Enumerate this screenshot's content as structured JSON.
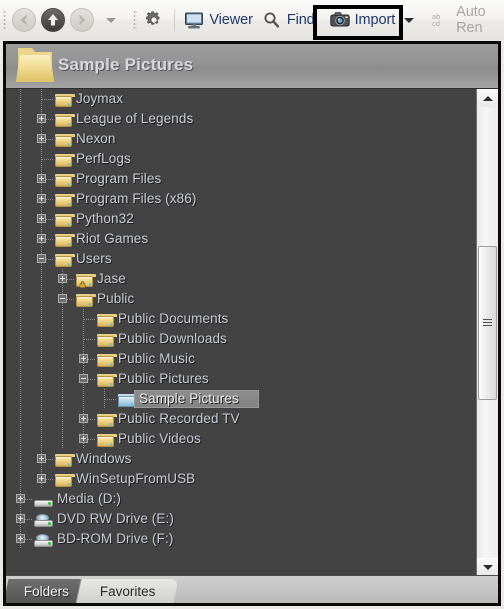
{
  "toolbar": {
    "nav": [
      {
        "name": "back-button",
        "state": "disabled",
        "icon": "arrow-left-icon"
      },
      {
        "name": "up-button",
        "state": "enabled",
        "icon": "arrow-up-icon"
      },
      {
        "name": "forward-button",
        "state": "disabled",
        "icon": "arrow-right-icon"
      },
      {
        "name": "history-dropdown",
        "state": "enabled",
        "icon": "chevron-down-icon"
      }
    ],
    "settings_icon": "gear-icon",
    "items": [
      {
        "label": "Viewer",
        "icon": "monitor-icon",
        "disabled": false,
        "highlighted": false,
        "dropdown": false
      },
      {
        "label": "Find",
        "icon": "magnifier-icon",
        "disabled": false,
        "highlighted": false,
        "dropdown": false
      },
      {
        "label": "Import",
        "icon": "camera-icon",
        "disabled": false,
        "highlighted": true,
        "dropdown": true
      },
      {
        "label": "Auto Ren",
        "icon": "abcd-icon",
        "disabled": true,
        "highlighted": false,
        "dropdown": false
      }
    ],
    "link_color": "#20386b",
    "highlight_color": "#000000"
  },
  "header": {
    "title": "Sample Pictures",
    "icon": "folder-icon"
  },
  "tree": {
    "selected": "Sample Pictures",
    "nodes": [
      {
        "label": "Joymax",
        "depth": 1,
        "expander": "none",
        "icon": "folder-icon"
      },
      {
        "label": "League of Legends",
        "depth": 1,
        "expander": "plus",
        "icon": "folder-icon"
      },
      {
        "label": "Nexon",
        "depth": 1,
        "expander": "plus",
        "icon": "folder-icon"
      },
      {
        "label": "PerfLogs",
        "depth": 1,
        "expander": "none",
        "icon": "folder-icon"
      },
      {
        "label": "Program Files",
        "depth": 1,
        "expander": "plus",
        "icon": "folder-icon"
      },
      {
        "label": "Program Files (x86)",
        "depth": 1,
        "expander": "plus",
        "icon": "folder-icon"
      },
      {
        "label": "Python32",
        "depth": 1,
        "expander": "plus",
        "icon": "folder-icon"
      },
      {
        "label": "Riot Games",
        "depth": 1,
        "expander": "plus",
        "icon": "folder-icon"
      },
      {
        "label": "Users",
        "depth": 1,
        "expander": "minus",
        "icon": "folder-icon"
      },
      {
        "label": "Jase",
        "depth": 2,
        "expander": "plus",
        "icon": "folder-locked-icon"
      },
      {
        "label": "Public",
        "depth": 2,
        "expander": "minus",
        "icon": "folder-icon"
      },
      {
        "label": "Public Documents",
        "depth": 3,
        "expander": "none",
        "icon": "folder-icon"
      },
      {
        "label": "Public Downloads",
        "depth": 3,
        "expander": "none",
        "icon": "folder-icon"
      },
      {
        "label": "Public Music",
        "depth": 3,
        "expander": "plus",
        "icon": "folder-icon"
      },
      {
        "label": "Public Pictures",
        "depth": 3,
        "expander": "minus",
        "icon": "folder-icon"
      },
      {
        "label": "Sample Pictures",
        "depth": 4,
        "expander": "none",
        "icon": "folder-blue-icon",
        "selected": true
      },
      {
        "label": "Public Recorded TV",
        "depth": 3,
        "expander": "plus",
        "icon": "folder-icon"
      },
      {
        "label": "Public Videos",
        "depth": 3,
        "expander": "plus",
        "icon": "folder-icon"
      },
      {
        "label": "Windows",
        "depth": 1,
        "expander": "plus",
        "icon": "folder-icon"
      },
      {
        "label": "WinSetupFromUSB",
        "depth": 1,
        "expander": "plus",
        "icon": "folder-icon"
      },
      {
        "label": "Media (D:)",
        "depth": 0,
        "expander": "plus",
        "icon": "hard-drive-icon"
      },
      {
        "label": "DVD RW Drive (E:)",
        "depth": 0,
        "expander": "plus",
        "icon": "optical-drive-icon"
      },
      {
        "label": "BD-ROM Drive (F:)",
        "depth": 0,
        "expander": "plus",
        "icon": "optical-drive-icon"
      }
    ]
  },
  "scrollbar": {
    "up_icon": "triangle-up-icon",
    "down_icon": "triangle-down-icon",
    "thumb_top_pct": 36,
    "thumb_height_pct": 40
  },
  "tabs": [
    {
      "label": "Folders",
      "active": true
    },
    {
      "label": "Favorites",
      "active": false
    }
  ]
}
